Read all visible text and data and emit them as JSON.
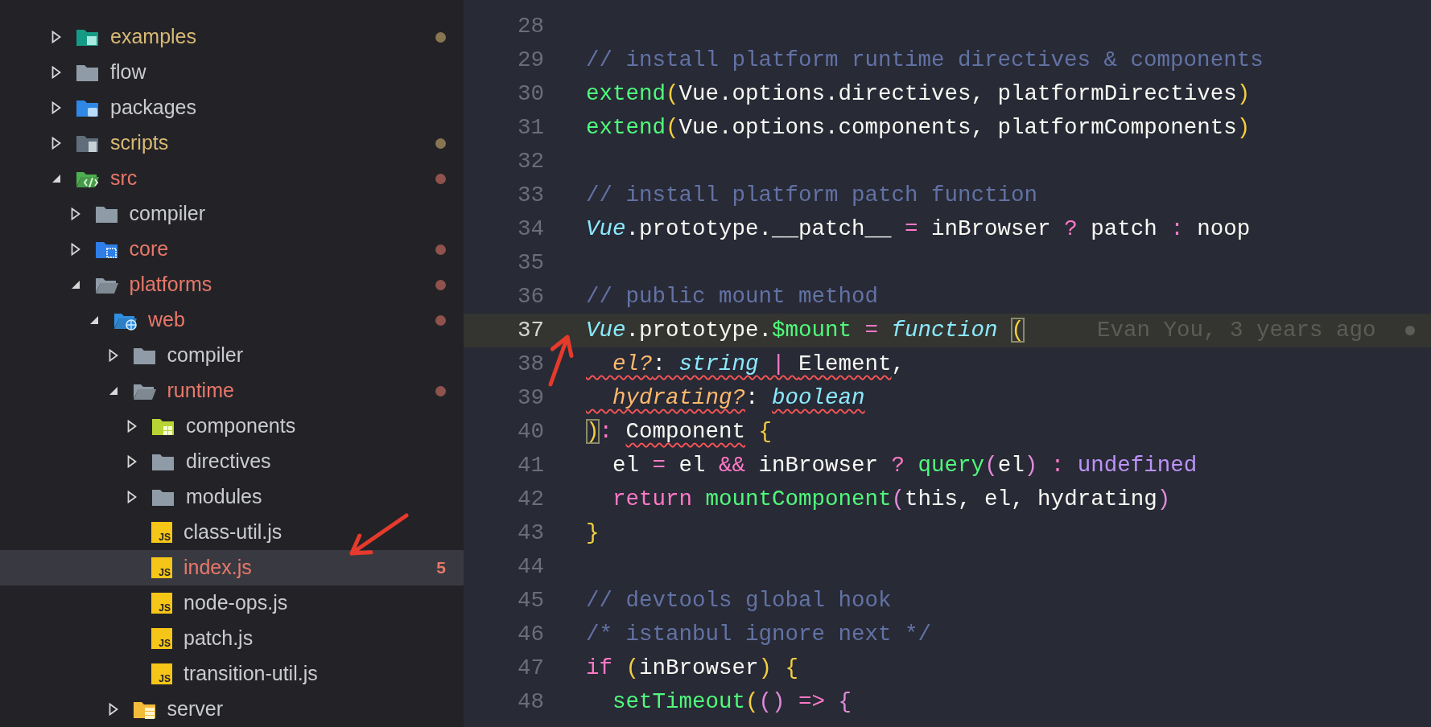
{
  "sidebar": {
    "tree": [
      {
        "name": "examples",
        "kind": "examples-folder",
        "expanded": false,
        "selected": false,
        "color": "#d9b974",
        "dot": true
      },
      {
        "name": "flow",
        "kind": "folder",
        "expanded": false,
        "selected": false,
        "color": "#c9cbcf",
        "dot": false
      },
      {
        "name": "packages",
        "kind": "package-folder",
        "expanded": false,
        "selected": false,
        "color": "#c9cbcf",
        "dot": false
      },
      {
        "name": "scripts",
        "kind": "script-folder",
        "expanded": false,
        "selected": false,
        "color": "#d9b974",
        "dot": true
      },
      {
        "name": "src",
        "kind": "source-folder",
        "expanded": true,
        "selected": false,
        "color": "#e8786a",
        "dot": true,
        "children": [
          {
            "name": "compiler",
            "kind": "folder",
            "expanded": false,
            "selected": false,
            "color": "#c9cbcf",
            "dot": false
          },
          {
            "name": "core",
            "kind": "core-folder",
            "expanded": false,
            "selected": false,
            "color": "#e8786a",
            "dot": true
          },
          {
            "name": "platforms",
            "kind": "folder",
            "expanded": true,
            "selected": false,
            "color": "#e8786a",
            "dot": true,
            "children": [
              {
                "name": "web",
                "kind": "web-folder",
                "expanded": true,
                "selected": false,
                "color": "#e8786a",
                "dot": true,
                "children": [
                  {
                    "name": "compiler",
                    "kind": "folder",
                    "expanded": false,
                    "selected": false,
                    "color": "#c9cbcf",
                    "dot": false
                  },
                  {
                    "name": "runtime",
                    "kind": "folder",
                    "expanded": true,
                    "selected": false,
                    "color": "#e8786a",
                    "dot": true,
                    "children": [
                      {
                        "name": "components",
                        "kind": "component-folder",
                        "expanded": false,
                        "selected": false,
                        "color": "#c9cbcf",
                        "dot": false
                      },
                      {
                        "name": "directives",
                        "kind": "folder",
                        "expanded": false,
                        "selected": false,
                        "color": "#c9cbcf",
                        "dot": false
                      },
                      {
                        "name": "modules",
                        "kind": "folder",
                        "expanded": false,
                        "selected": false,
                        "color": "#c9cbcf",
                        "dot": false
                      },
                      {
                        "name": "class-util.js",
                        "kind": "file",
                        "glyph": "JS",
                        "selected": false,
                        "color": "#c9cbcf",
                        "dot": false
                      },
                      {
                        "name": "index.js",
                        "kind": "file",
                        "glyph": "JS",
                        "selected": true,
                        "color": "#e8786a",
                        "dot": false,
                        "badge": "5"
                      },
                      {
                        "name": "node-ops.js",
                        "kind": "file",
                        "glyph": "JS",
                        "selected": false,
                        "color": "#c9cbcf",
                        "dot": false
                      },
                      {
                        "name": "patch.js",
                        "kind": "file",
                        "glyph": "JS",
                        "selected": false,
                        "color": "#c9cbcf",
                        "dot": false
                      },
                      {
                        "name": "transition-util.js",
                        "kind": "file",
                        "glyph": "JS",
                        "selected": false,
                        "color": "#c9cbcf",
                        "dot": false
                      }
                    ]
                  },
                  {
                    "name": "server",
                    "kind": "server-folder",
                    "expanded": false,
                    "selected": false,
                    "color": "#c9cbcf",
                    "dot": false
                  }
                ]
              }
            ]
          }
        ]
      }
    ]
  },
  "editor": {
    "lines": [
      {
        "number": "28",
        "current": false
      },
      {
        "number": "29",
        "current": false,
        "tokens": [
          {
            "t": "// install platform runtime directives & components",
            "kind": "comment"
          }
        ]
      },
      {
        "number": "30",
        "current": false,
        "tokens": [
          {
            "t": "extend",
            "kind": "fn"
          },
          {
            "t": "(",
            "kind": "paren"
          },
          {
            "t": "Vue.options.directives, platformDirectives",
            "kind": "plain"
          },
          {
            "t": ")",
            "kind": "paren"
          }
        ]
      },
      {
        "number": "31",
        "current": false,
        "tokens": [
          {
            "t": "extend",
            "kind": "fn"
          },
          {
            "t": "(",
            "kind": "paren"
          },
          {
            "t": "Vue.options.components, platformComponents",
            "kind": "plain"
          },
          {
            "t": ")",
            "kind": "paren"
          }
        ]
      },
      {
        "number": "32",
        "current": false
      },
      {
        "number": "33",
        "current": false,
        "tokens": [
          {
            "t": "// install platform patch function",
            "kind": "comment"
          }
        ]
      },
      {
        "number": "34",
        "current": false,
        "tokens": [
          {
            "t": "Vue",
            "kind": "cls"
          },
          {
            "t": ".prototype.__patch__",
            "kind": "plain"
          },
          {
            "t": " = ",
            "kind": "op"
          },
          {
            "t": "inBrowser",
            "kind": "plain"
          },
          {
            "t": " ? ",
            "kind": "op"
          },
          {
            "t": "patch",
            "kind": "plain"
          },
          {
            "t": " : ",
            "kind": "op"
          },
          {
            "t": "noop",
            "kind": "plain"
          }
        ]
      },
      {
        "number": "35",
        "current": false
      },
      {
        "number": "36",
        "current": false,
        "tokens": [
          {
            "t": "// public mount method",
            "kind": "comment"
          }
        ]
      },
      {
        "number": "37",
        "current": true,
        "blame": "Evan You, 3 years ago",
        "tokens": [
          {
            "t": "Vue",
            "kind": "cls"
          },
          {
            "t": ".prototype.",
            "kind": "plain"
          },
          {
            "t": "$mount",
            "kind": "fn"
          },
          {
            "t": " = ",
            "kind": "op"
          },
          {
            "t": "function ",
            "kind": "kw"
          },
          {
            "t": "(",
            "kind": "match"
          }
        ]
      },
      {
        "number": "38",
        "current": false,
        "tokens": [
          {
            "t": "  el?",
            "kind": "param",
            "squiggle": true
          },
          {
            "t": ": ",
            "kind": "plain",
            "squiggle": true
          },
          {
            "t": "string",
            "kind": "type",
            "squiggle": true
          },
          {
            "t": " | ",
            "kind": "op",
            "squiggle": true
          },
          {
            "t": "Element",
            "kind": "plain",
            "squiggle": true
          },
          {
            "t": ",",
            "kind": "plain"
          }
        ]
      },
      {
        "number": "39",
        "current": false,
        "tokens": [
          {
            "t": "  hydrating?",
            "kind": "param",
            "squiggle": true
          },
          {
            "t": ": ",
            "kind": "plain"
          },
          {
            "t": "boolean",
            "kind": "type",
            "squiggle": true
          }
        ]
      },
      {
        "number": "40",
        "current": false,
        "tokens": [
          {
            "t": ")",
            "kind": "match"
          },
          {
            "t": ": ",
            "kind": "op"
          },
          {
            "t": "Component",
            "kind": "plain",
            "squiggle": true
          },
          {
            "t": " {",
            "kind": "paren"
          }
        ]
      },
      {
        "number": "41",
        "current": false,
        "tokens": [
          {
            "t": "  el",
            "kind": "plain"
          },
          {
            "t": " = ",
            "kind": "op"
          },
          {
            "t": "el",
            "kind": "plain"
          },
          {
            "t": " && ",
            "kind": "op"
          },
          {
            "t": "inBrowser",
            "kind": "plain"
          },
          {
            "t": " ? ",
            "kind": "op"
          },
          {
            "t": "query",
            "kind": "fn"
          },
          {
            "t": "(",
            "kind": "paren2"
          },
          {
            "t": "el",
            "kind": "plain"
          },
          {
            "t": ")",
            "kind": "paren2"
          },
          {
            "t": " : ",
            "kind": "op"
          },
          {
            "t": "undefined",
            "kind": "const"
          }
        ]
      },
      {
        "number": "42",
        "current": false,
        "tokens": [
          {
            "t": "  return ",
            "kind": "kw2"
          },
          {
            "t": "mountComponent",
            "kind": "fn"
          },
          {
            "t": "(",
            "kind": "paren2"
          },
          {
            "t": "this, el, hydrating",
            "kind": "plain"
          },
          {
            "t": ")",
            "kind": "paren2"
          }
        ]
      },
      {
        "number": "43",
        "current": false,
        "tokens": [
          {
            "t": "}",
            "kind": "paren"
          }
        ]
      },
      {
        "number": "44",
        "current": false
      },
      {
        "number": "45",
        "current": false,
        "tokens": [
          {
            "t": "// devtools global hook",
            "kind": "comment"
          }
        ]
      },
      {
        "number": "46",
        "current": false,
        "tokens": [
          {
            "t": "/* istanbul ignore next */",
            "kind": "comment"
          }
        ]
      },
      {
        "number": "47",
        "current": false,
        "tokens": [
          {
            "t": "if ",
            "kind": "kw2"
          },
          {
            "t": "(",
            "kind": "paren"
          },
          {
            "t": "inBrowser",
            "kind": "plain"
          },
          {
            "t": ") {",
            "kind": "paren"
          }
        ]
      },
      {
        "number": "48",
        "current": false,
        "tokens": [
          {
            "t": "  setTimeout",
            "kind": "fn"
          },
          {
            "t": "(",
            "kind": "paren"
          },
          {
            "t": "()",
            "kind": "paren2"
          },
          {
            "t": " => ",
            "kind": "op"
          },
          {
            "t": "{",
            "kind": "paren2"
          }
        ]
      }
    ]
  }
}
